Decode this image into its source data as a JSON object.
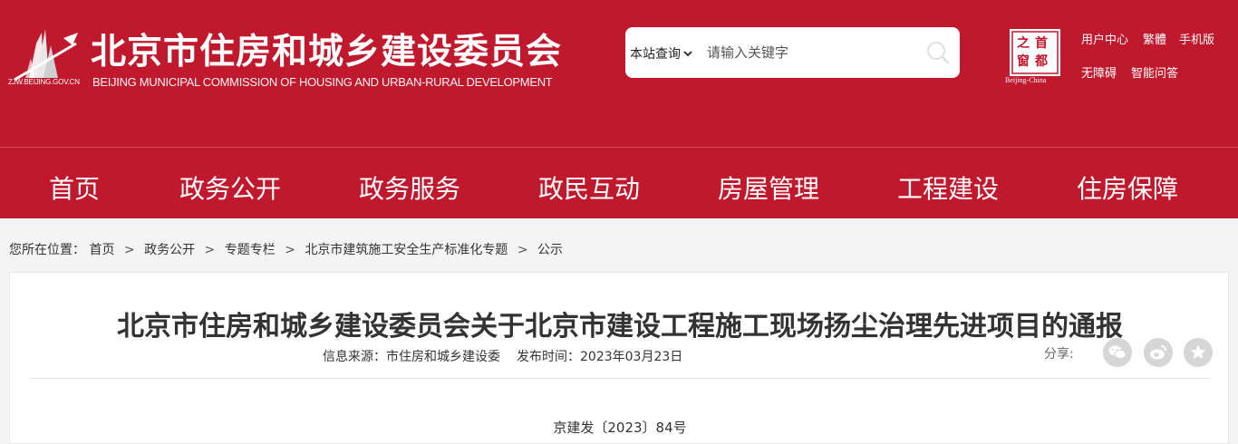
{
  "header": {
    "logo_url": "ZJW.BEIJING.GOV.CN",
    "title": "北京市住房和城乡建设委员会",
    "subtitle": "BEIJING MUNICIPAL COMMISSION OF HOUSING AND URBAN-RURAL DEVELOPMENT",
    "brand_color": "#c0182d",
    "search": {
      "scope": "本站查询",
      "placeholder": "请输入关键字"
    },
    "capital_window": {
      "chars": [
        "首",
        "都",
        "之",
        "窗"
      ],
      "en": "Beijing-China"
    },
    "util_links": [
      "用户中心",
      "繁體",
      "手机版",
      "无障碍",
      "智能问答"
    ]
  },
  "nav": {
    "items": [
      "首页",
      "政务公开",
      "政务服务",
      "政民互动",
      "房屋管理",
      "工程建设",
      "住房保障"
    ]
  },
  "breadcrumb": {
    "prefix": "您所在位置：",
    "items": [
      "首页",
      "政务公开",
      "专题专栏",
      "北京市建筑施工安全生产标准化专题",
      "公示"
    ],
    "separator": ">"
  },
  "article": {
    "title": "北京市住房和城乡建设委员会关于北京市建设工程施工现场扬尘治理先进项目的通报",
    "source_label": "信息来源：",
    "source": "市住房和城乡建设委",
    "date_label": "发布时间：",
    "date": "2023年03月23日",
    "share_label": "分享:",
    "share_buttons": [
      "wechat-icon",
      "weibo-icon",
      "favorite-icon"
    ],
    "doc_number": "京建发〔2023〕84号"
  }
}
